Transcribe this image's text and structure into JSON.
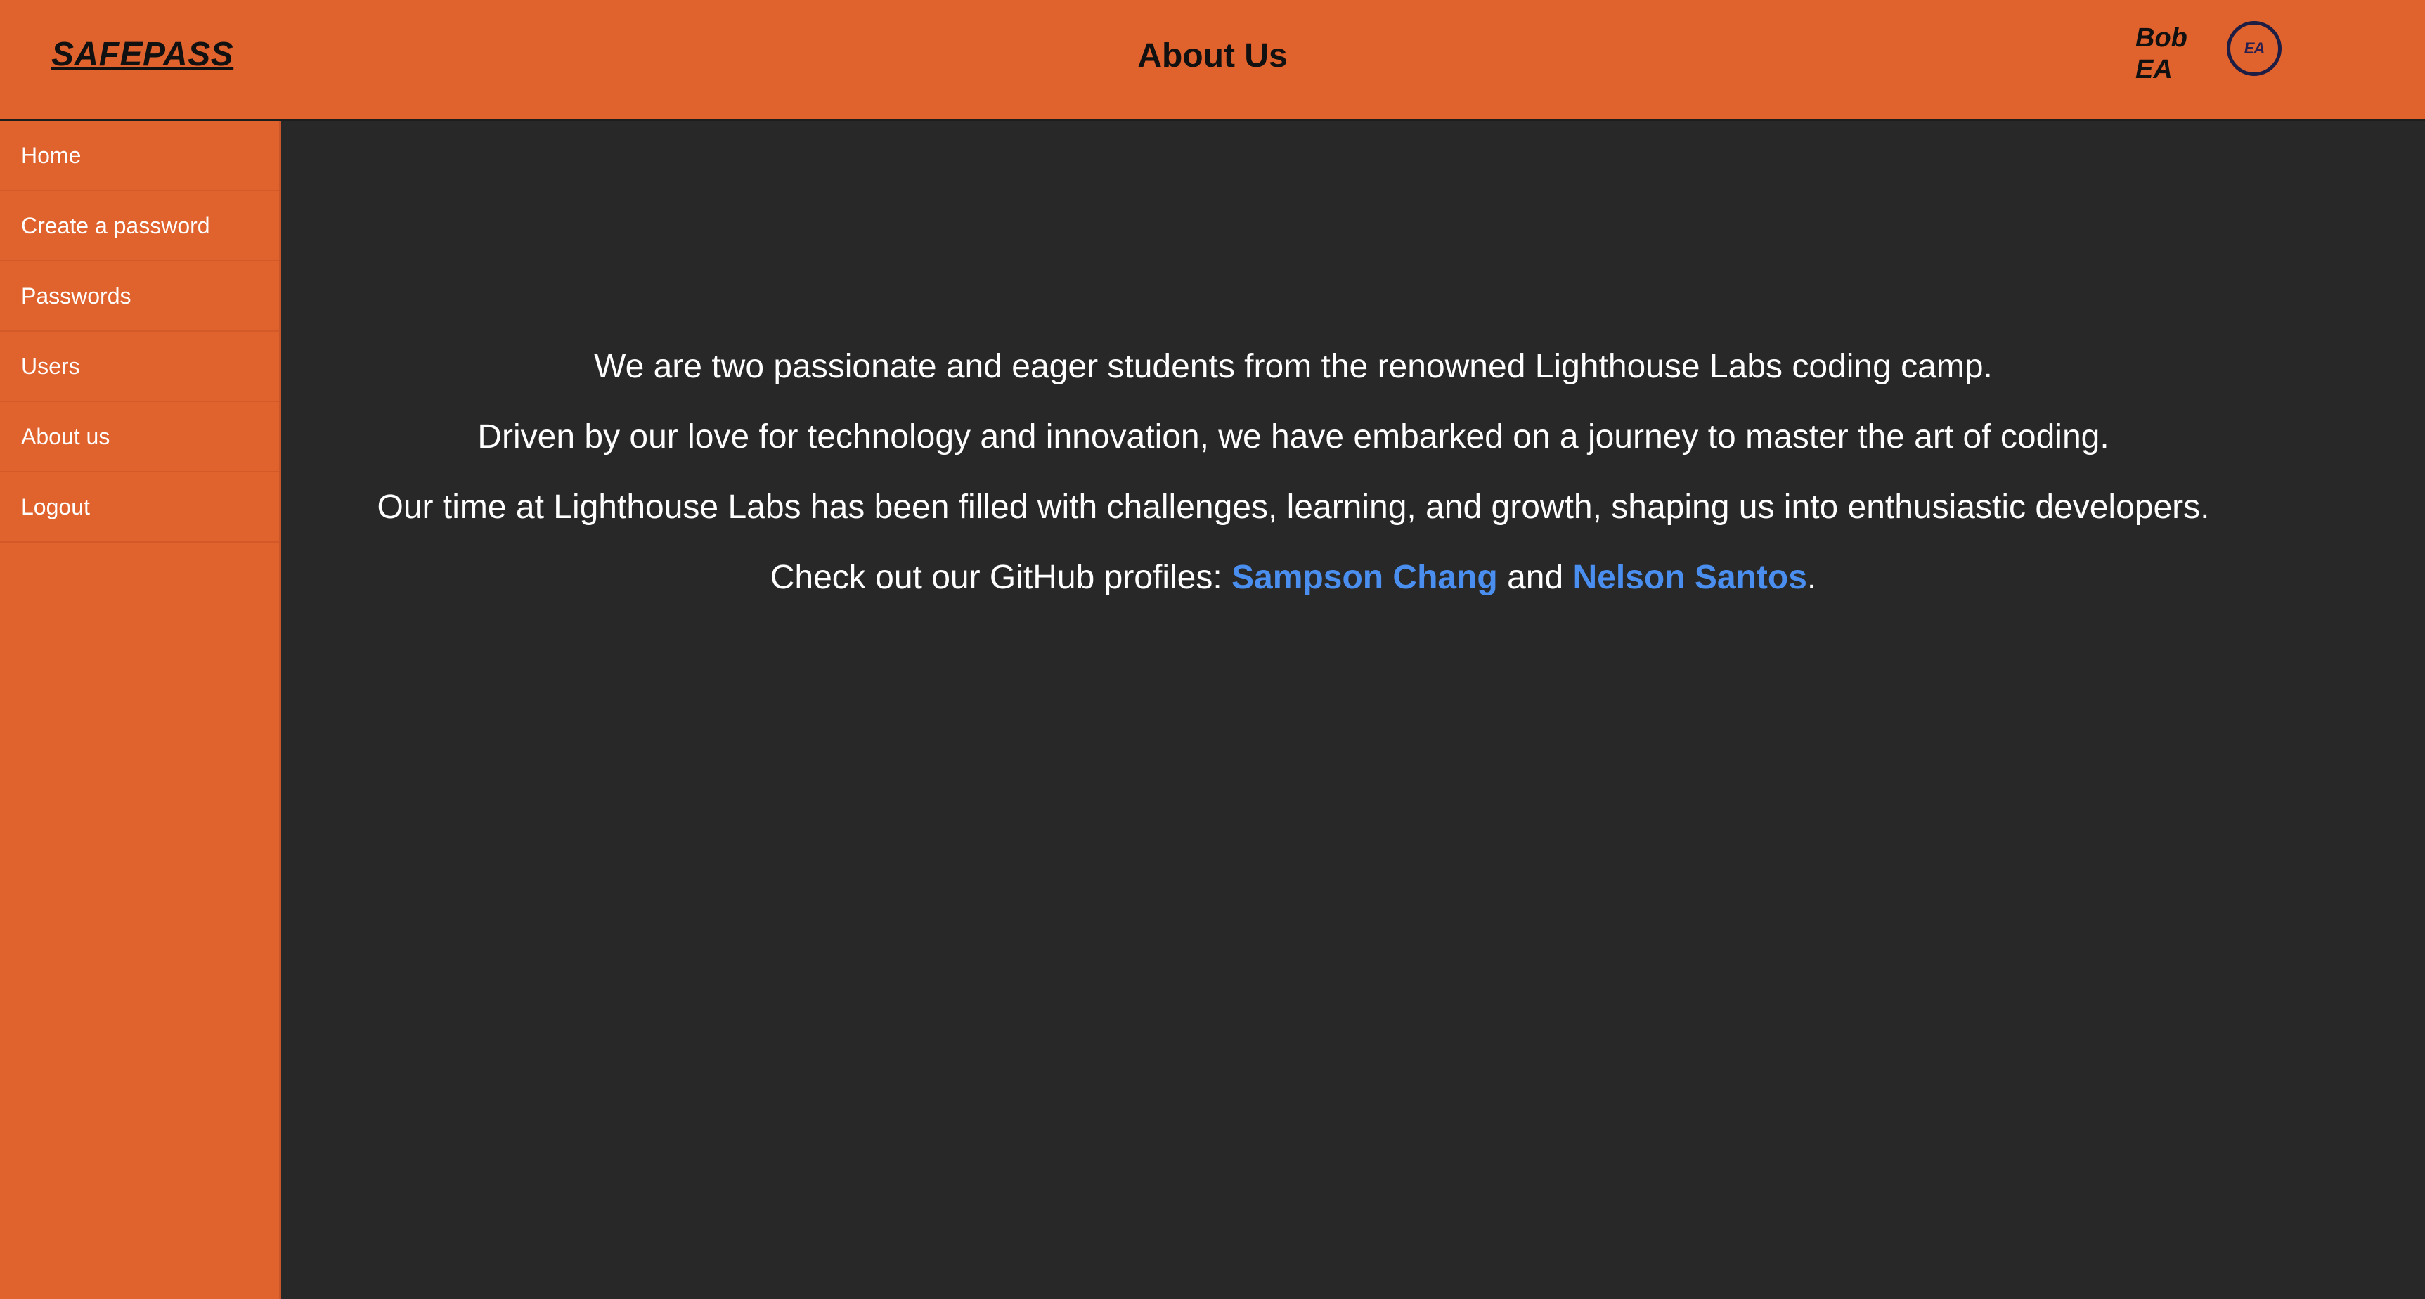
{
  "header": {
    "logo": "SAFEPASS",
    "title": "About Us",
    "user_name": "Bob EA",
    "avatar_text": "EA",
    "brand_color": "#e0622d"
  },
  "sidebar": {
    "items": [
      {
        "label": "Home"
      },
      {
        "label": "Create a password"
      },
      {
        "label": "Passwords"
      },
      {
        "label": "Users"
      },
      {
        "label": "About us"
      },
      {
        "label": "Logout"
      }
    ]
  },
  "main": {
    "paragraphs": [
      "We are two passionate and eager students from the renowned Lighthouse Labs coding camp.",
      "Driven by our love for technology and innovation, we have embarked on a journey to master the art of coding.",
      "Our time at Lighthouse Labs has been filled with challenges, learning, and growth, shaping us into enthusiastic developers."
    ],
    "github": {
      "prefix": "Check out our GitHub profiles: ",
      "link1": "Sampson Chang",
      "connector": " and ",
      "link2": "Nelson Santos",
      "suffix": "."
    },
    "link_color": "#4a8ff0",
    "background_color": "#282828"
  }
}
